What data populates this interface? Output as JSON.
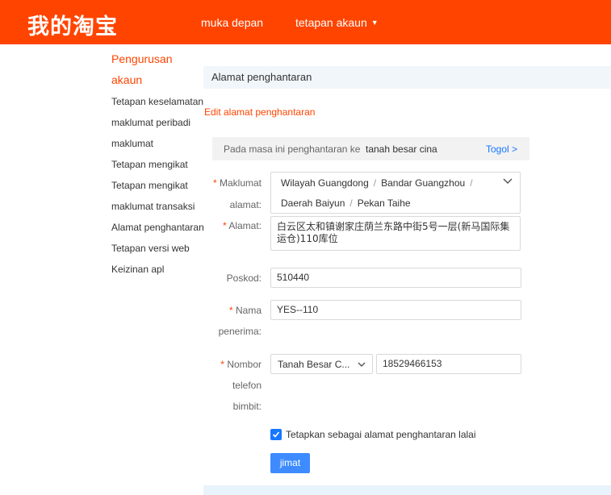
{
  "header": {
    "logo": "我的淘宝",
    "nav_home": "muka depan",
    "nav_settings": "tetapan akaun"
  },
  "sidebar": {
    "title_line1": "Pengurusan",
    "title_line2": "akaun",
    "items": [
      "Tetapan keselamatan",
      "maklumat peribadi",
      "maklumat",
      "Tetapan mengikat",
      "Tetapan mengikat",
      "maklumat transaksi",
      "Alamat penghantaran",
      "Tetapan versi web",
      "Keizinan apl"
    ]
  },
  "main": {
    "panel_title": "Alamat penghantaran",
    "edit_title": "Edit alamat penghantaran",
    "region_bar": {
      "label": "Pada masa ini penghantaran ke",
      "value": "tanah besar cina",
      "toggle": "Togol >"
    },
    "form": {
      "region_label_1": "Maklumat",
      "region_label_2": "alamat:",
      "region_parts_line1": [
        "Wilayah Guangdong",
        "Bandar Guangzhou"
      ],
      "region_parts_line2": [
        "Daerah Baiyun",
        "Pekan Taihe"
      ],
      "address_label": "Alamat:",
      "address_value": "白云区太和镇谢家庄荫兰东路中街5号一层(新马国际集运仓)110库位",
      "postcode_label": "Poskod:",
      "postcode_value": "510440",
      "receiver_label_1": "Nama",
      "receiver_label_2": "penerima:",
      "receiver_value": "YES--110",
      "phone_label_1": "Nombor",
      "phone_label_2": "telefon",
      "phone_label_3": "bimbit:",
      "country_value": "Tanah Besar C...",
      "phone_value": "18529466153",
      "default_checkbox_label": "Tetapkan sebagai alamat penghantaran lalai",
      "default_checked": true,
      "save_label": "jimat",
      "required_mark": "*"
    }
  },
  "colors": {
    "brand": "#ff4400",
    "link": "#1677ff",
    "button": "#3d8bff"
  }
}
